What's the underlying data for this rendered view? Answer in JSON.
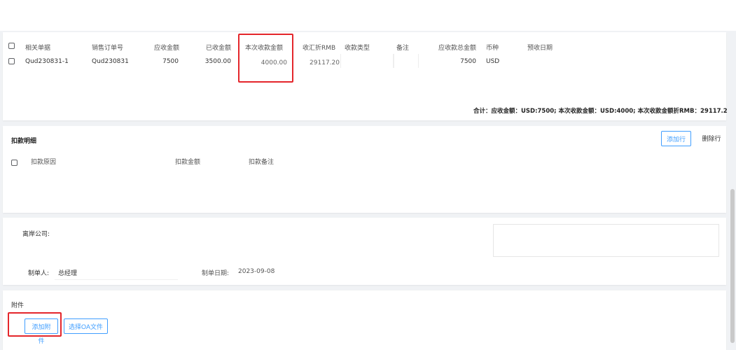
{
  "receipt_table": {
    "headers": [
      "相关单据",
      "销售订单号",
      "应收金额",
      "已收金额",
      "本次收款金额",
      "收汇折RMB",
      "收款类型",
      "备注",
      "应收款总金额",
      "币种",
      "预收日期"
    ],
    "rows": [
      {
        "doc": "Qud230831-1",
        "order": "Qud230831",
        "receivable": "7500",
        "received": "3500.00",
        "this_receipt": "4000.00",
        "rmb": "29117.20",
        "type": "",
        "remark": "",
        "total": "7500",
        "currency": "USD",
        "date": ""
      }
    ],
    "total_label": "合计：",
    "total_text": "应收金额：USD:7500; 本次收款金额：USD:4000; 本次收款金额折RMB：29117.2"
  },
  "deduction": {
    "title": "扣款明细",
    "headers": [
      "扣款原因",
      "扣款金额",
      "扣款备注"
    ],
    "add_row": "添加行",
    "delete_row": "删除行"
  },
  "form": {
    "company_label": "离岸公司:",
    "maker_label": "制单人:",
    "maker_value": "总经理",
    "date_label": "制单日期:",
    "date_value": "2023-09-08"
  },
  "attachments": {
    "title": "附件",
    "add": "添加附件",
    "select_oa": "选择OA文件"
  },
  "colors": {
    "accent": "#409eff",
    "highlight": "#e4262b"
  },
  "icons": [
    "checkbox-icon"
  ]
}
